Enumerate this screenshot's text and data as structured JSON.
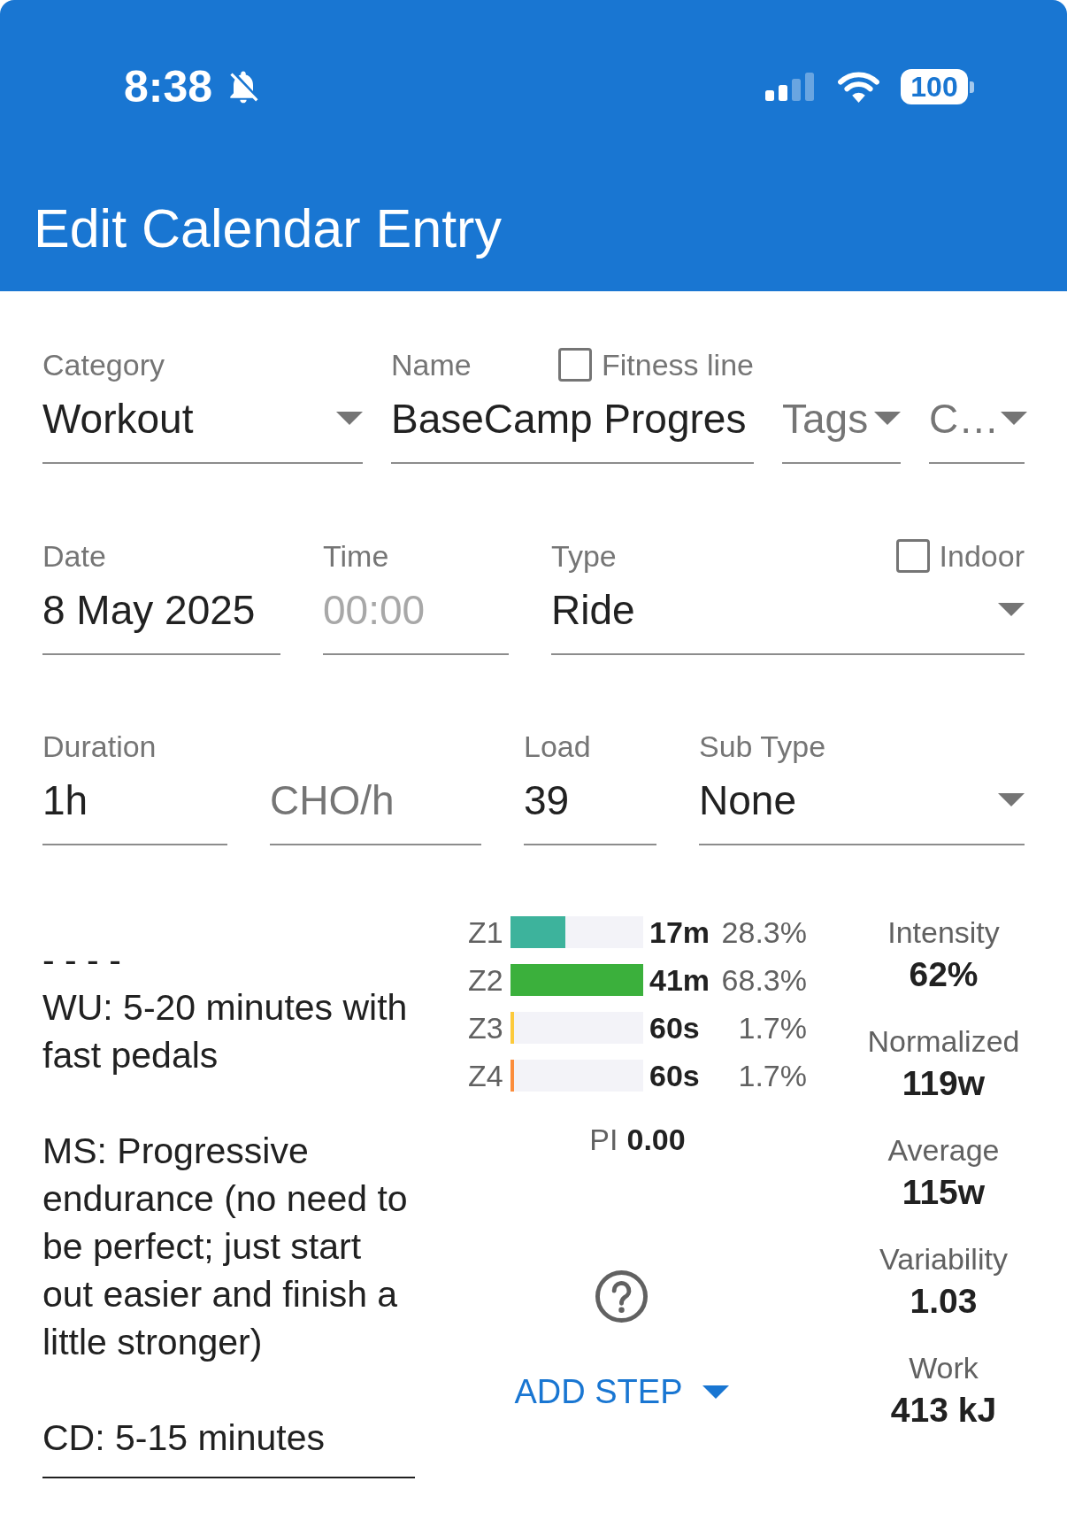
{
  "status_bar": {
    "time": "8:38",
    "battery": "100"
  },
  "app_bar": {
    "title": "Edit Calendar Entry"
  },
  "category": {
    "label": "Category",
    "value": "Workout"
  },
  "name": {
    "label": "Name",
    "value": "BaseCamp Progres"
  },
  "fitness_line": {
    "label": "Fitness line",
    "checked": false
  },
  "tags": {
    "placeholder": "Tags"
  },
  "field_4": {
    "placeholder": "C…"
  },
  "date": {
    "label": "Date",
    "value": "8 May 2025"
  },
  "time": {
    "label": "Time",
    "placeholder": "00:00"
  },
  "type": {
    "label": "Type",
    "value": "Ride"
  },
  "indoor": {
    "label": "Indoor",
    "checked": false
  },
  "duration": {
    "label": "Duration",
    "value": "1h"
  },
  "cho": {
    "placeholder": "CHO/h"
  },
  "load": {
    "label": "Load",
    "value": "39"
  },
  "sub_type": {
    "label": "Sub Type",
    "value": "None"
  },
  "description": {
    "value": "- - - -\nWU: 5-20 minutes with fast pedals\n\nMS: Progressive endurance (no need to be perfect; just start out easier and finish a little stronger)\n\nCD: 5-15 minutes"
  },
  "zones": [
    {
      "label": "Z1",
      "color": "#3db39c",
      "level": 0.414,
      "time": "17m",
      "percent": "28.3%"
    },
    {
      "label": "Z2",
      "color": "#3bb03c",
      "level": 1,
      "time": "41m",
      "percent": "68.3%"
    },
    {
      "label": "Z3",
      "color": "#fcca3c",
      "level": 0.027,
      "time": "60s",
      "percent": "1.7%"
    },
    {
      "label": "Z4",
      "color": "#fb8d3c",
      "level": 0.027,
      "time": "60s",
      "percent": "1.7%"
    }
  ],
  "pi": {
    "label": "PI",
    "value": "0.00"
  },
  "add_step": {
    "label": "ADD STEP"
  },
  "stats": [
    {
      "label": "Intensity",
      "value": "62%"
    },
    {
      "label": "Normalized",
      "value": "119w"
    },
    {
      "label": "Average",
      "value": "115w"
    },
    {
      "label": "Variability",
      "value": "1.03"
    },
    {
      "label": "Work",
      "value": "413 kJ"
    }
  ]
}
